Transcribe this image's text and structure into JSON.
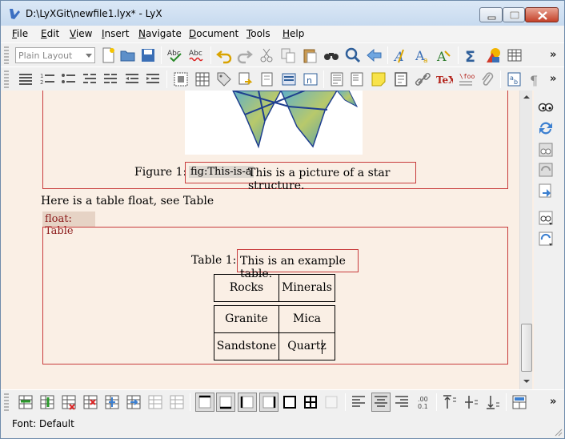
{
  "window": {
    "title": "D:\\LyXGit\\newfile1.lyx* - LyX",
    "min_icon": "minimize-icon",
    "max_icon": "maximize-icon",
    "close_icon": "close-icon"
  },
  "menubar": {
    "items": [
      {
        "label": "File",
        "key": "F",
        "rest": "ile"
      },
      {
        "label": "Edit",
        "key": "E",
        "rest": "dit"
      },
      {
        "label": "View",
        "key": "V",
        "rest": "iew"
      },
      {
        "label": "Insert",
        "key": "I",
        "rest": "nsert"
      },
      {
        "label": "Navigate",
        "key": "N",
        "rest": "avigate"
      },
      {
        "label": "Document",
        "key": "D",
        "rest": "ocument"
      },
      {
        "label": "Tools",
        "key": "T",
        "rest": "ools"
      },
      {
        "label": "Help",
        "key": "H",
        "rest": "elp"
      }
    ]
  },
  "toolbar_main": {
    "layout_select": "Plain Layout",
    "more": "»"
  },
  "toolbar_format": {
    "more": "»"
  },
  "toolbar_table": {
    "more": "»"
  },
  "document": {
    "figure_caption_prefix": "Figure 1:",
    "figure_label": "fig:This-is-a",
    "figure_caption": "This is a picture of a star structure.",
    "body_text": "Here is a table float, see Table",
    "float_label": "float: Table",
    "table_caption_prefix": "Table 1:",
    "table_caption": "This is an example table.",
    "table": {
      "header": [
        "Rocks",
        "Minerals"
      ],
      "rows": [
        [
          "Granite",
          "Mica"
        ],
        [
          "Sandstone",
          "Quartz"
        ]
      ]
    }
  },
  "statusbar": {
    "text": "Font: Default"
  },
  "colors": {
    "workarea": "#faefe5",
    "inset_frame": "#c83c3c",
    "float_label_text": "#8b1a1a"
  }
}
